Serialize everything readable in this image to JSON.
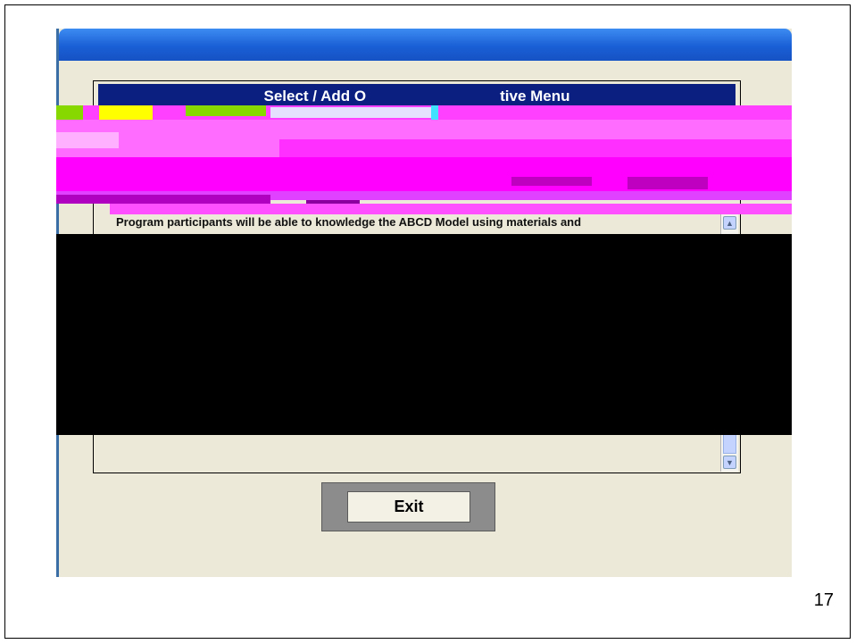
{
  "menu": {
    "header_title": "Select / Add O",
    "header_title_tail": "tive Menu"
  },
  "objective": {
    "text": "Program participants will be able to knowledge the ABCD Model using materials and"
  },
  "buttons": {
    "exit_label": "Exit"
  },
  "scrollbar": {
    "up_glyph": "▲",
    "down_glyph": "▼"
  },
  "slide": {
    "page_number": "17"
  },
  "colors": {
    "title_bar": "#1a5fd6",
    "menu_header": "#0b1f80",
    "window_bg": "#ece9d8",
    "glitch_magenta": "#ff40ff",
    "glitch_yellow": "#ffff00",
    "glitch_green": "#86d800"
  }
}
